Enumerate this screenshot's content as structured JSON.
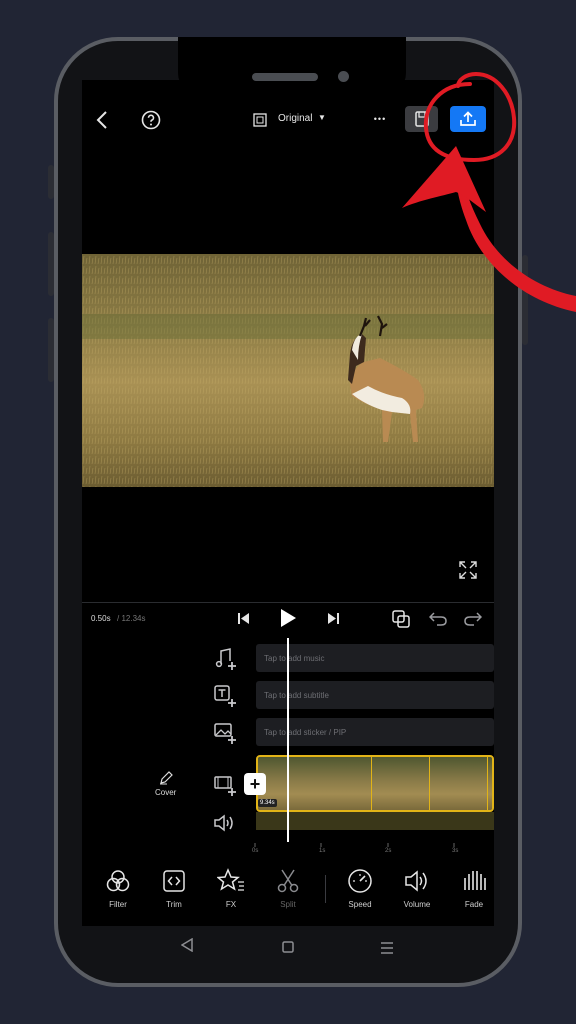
{
  "topbar": {
    "ratio_label": "Original",
    "ratio_caret": "▼",
    "more_glyph": "•••"
  },
  "transport": {
    "current_time": "0.50s",
    "total_time": "/ 12.34s"
  },
  "tracks": {
    "music_placeholder": "Tap to add music",
    "subtitle_placeholder": "Tap to add subtitle",
    "sticker_placeholder": "Tap to add sticker / PIP",
    "clip_duration": "9.34s",
    "add_clip_glyph": "+",
    "cover_label": "Cover"
  },
  "ruler": {
    "labels": [
      "0s",
      "1s",
      "2s",
      "3s"
    ]
  },
  "toolbar": {
    "filter_label": "Filter",
    "trim_label": "Trim",
    "fx_label": "FX",
    "split_label": "Split",
    "speed_label": "Speed",
    "volume_label": "Volume",
    "fade_label": "Fade"
  },
  "colors": {
    "export_accent": "#1478f5",
    "clip_border": "#e2b417",
    "annotation_red": "#e01b24"
  },
  "icons": [
    "back-icon",
    "help-icon",
    "ratio-icon",
    "more-icon",
    "draft-icon",
    "export-icon",
    "fullscreen-icon",
    "skip-start-icon",
    "play-icon",
    "skip-end-icon",
    "keyframe-icon",
    "undo-icon",
    "redo-icon",
    "music-add-icon",
    "text-add-icon",
    "image-add-icon",
    "video-add-icon",
    "volume-track-icon",
    "pen-icon",
    "filter-icon",
    "trim-icon",
    "fx-icon",
    "scissors-icon",
    "speed-icon",
    "volume-icon",
    "fade-icon",
    "nav-back-icon",
    "nav-home-icon",
    "nav-menu-icon"
  ]
}
